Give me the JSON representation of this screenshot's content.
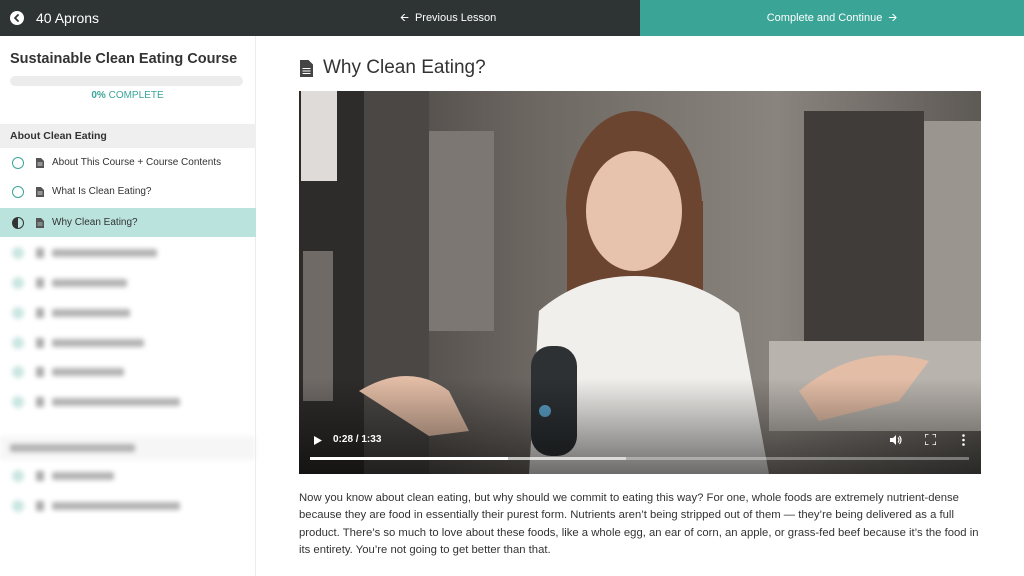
{
  "topbar": {
    "brand_name": "40 Aprons",
    "back_icon": "chevron-left-circle-icon",
    "previous_lesson_label": "Previous Lesson",
    "complete_label": "Complete and Continue",
    "complete_color": "#3aa597",
    "bar_color": "#2e3433"
  },
  "sidebar": {
    "course_title": "Sustainable Clean Eating Course",
    "progress_percent": "0%",
    "progress_fraction": 0,
    "progress_suffix": " COMPLETE",
    "sections": [
      {
        "title": "About Clean Eating",
        "lessons": [
          {
            "label": "About This Course + Course Contents",
            "status": "not-started"
          },
          {
            "label": "What Is Clean Eating?",
            "status": "not-started"
          },
          {
            "label": "Why Clean Eating?",
            "status": "in-progress",
            "active": true
          }
        ]
      }
    ]
  },
  "main": {
    "lesson_title": "Why Clean Eating?",
    "video": {
      "current_time": "0:28",
      "duration": "1:33",
      "progress_fraction": 0.3,
      "buffered_fraction": 0.48
    },
    "body_text": "Now you know about clean eating, but why should we commit to eating this way? For one, whole foods are extremely nutrient-dense because they are food in essentially their purest form. Nutrients aren’t being stripped out of them — they’re being delivered as a full product. There’s so much to love about these foods, like a whole egg, an ear of corn, an apple, or grass-fed beef because it’s the food in its entirety. You’re not going to get better than that."
  }
}
